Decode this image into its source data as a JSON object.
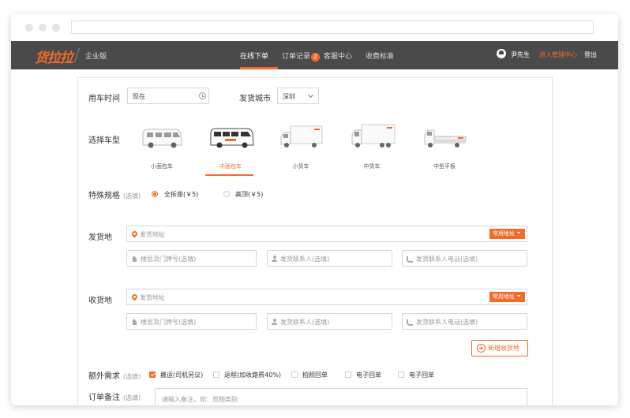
{
  "header": {
    "logo": "货拉拉",
    "edition": "企业版",
    "nav": [
      {
        "label": "在线下单"
      },
      {
        "label": "订单记录",
        "badge": "2"
      },
      {
        "label": "客服中心"
      },
      {
        "label": "收费标准"
      }
    ],
    "user_name": "尹先生",
    "admin_link": "进入管理中心",
    "logout": "登出"
  },
  "form": {
    "time_label": "用车时间",
    "time_value": "现在",
    "city_label": "发货城市",
    "city_value": "深圳",
    "vehicle_label": "选择车型",
    "vehicles": [
      {
        "label": "小面包车"
      },
      {
        "label": "中面包车"
      },
      {
        "label": "小货车"
      },
      {
        "label": "中货车"
      },
      {
        "label": "中型平板"
      }
    ],
    "selected_vehicle": "中面包车",
    "special_label": "特殊规格",
    "optional_tag": "(选填)",
    "special_options": [
      "全拆座(￥5)",
      "高顶(￥5)"
    ],
    "special_selected": "全拆座(￥5)",
    "pickup_label": "发货地",
    "dropoff_label": "收货地",
    "address_placeholder": "发货地址",
    "common_address_btn": "常用地址",
    "floor_placeholder": "楼层及门牌号(选填)",
    "contact_placeholder": "发货联系人(选填)",
    "phone_placeholder": "发货联系人电话(选填)",
    "add_dropoff_btn": "新增收货地",
    "extra_label": "额外需求",
    "extras": [
      {
        "label": "搬运(司机另议)",
        "checked": true
      },
      {
        "label": "返程(加收路费40%)",
        "checked": false
      },
      {
        "label": "拍照回单",
        "checked": false
      },
      {
        "label": "电子回单",
        "checked": false
      },
      {
        "label": "电子回单",
        "checked": false
      }
    ],
    "remark_label": "订单备注",
    "remark_placeholder": "请输入备注，如：货物类别"
  },
  "colors": {
    "accent": "#f26b2a",
    "nav_bg": "#4a4a4a"
  }
}
